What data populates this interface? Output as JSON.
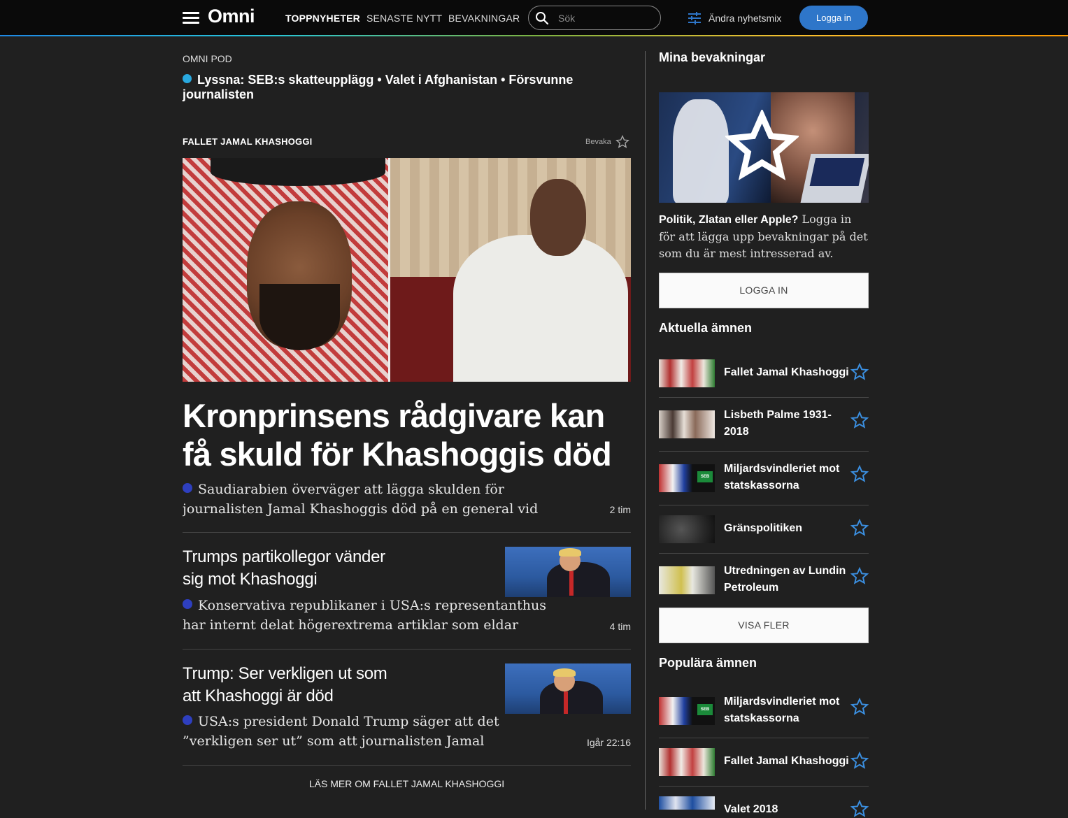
{
  "header": {
    "logo": "Omni",
    "nav": [
      "TOPPNYHETER",
      "SENASTE NYTT",
      "BEVAKNINGAR"
    ],
    "search_placeholder": "Sök",
    "mix_label": "Ändra nyhetsmix",
    "login_label": "Logga in"
  },
  "pod": {
    "label": "OMNI POD",
    "text": "Lyssna: SEB:s skatteupplägg • Valet i Afghanistan • Försvunne journalisten"
  },
  "topic": {
    "label": "FALLET JAMAL KHASHOGGI",
    "follow_label": "Bevaka"
  },
  "main_story": {
    "headline": "Kronprinsens rådgivare kan få skuld för Khashoggis död",
    "lead": "Saudiarabien överväger att lägga skulden för journalisten Jamal Khashoggis död på en general vid namn Ahmed al-Assiri. Det skriver",
    "time": "2 tim"
  },
  "stories": [
    {
      "title": "Trumps partikollegor vänder sig mot Khashoggi",
      "lead": "Konservativa republikaner i USA:s representanthus har internt delat högerextrema artiklar som eldar",
      "time": "4 tim"
    },
    {
      "title": "Trump: Ser verkligen ut som att Khashoggi är död",
      "lead": "USA:s president Donald Trump säger att det ”verkligen ser ut” som att journalisten Jamal Khashoggi är död",
      "time": "Igår 22:16"
    }
  ],
  "more_link": "LÄS MER OM FALLET JAMAL KHASHOGGI",
  "sidebar": {
    "my_follows_title": "Mina bevakningar",
    "promo_bold": "Politik, Zlatan eller Apple?",
    "promo_text": " Logga in för att lägga upp bevakningar på det som du är mest intresserad av.",
    "login_button": "LOGGA IN",
    "current_title": "Aktuella ämnen",
    "current_topics": [
      "Fallet Jamal Khashoggi",
      "Lisbeth Palme 1931-2018",
      "Miljardsvindleriet mot statskassorna",
      "Gränspolitiken",
      "Utredningen av Lundin Petroleum"
    ],
    "show_more": "VISA FLER",
    "popular_title": "Populära ämnen",
    "popular_topics": [
      "Miljardsvindleriet mot statskassorna",
      "Fallet Jamal Khashoggi",
      "Valet 2018"
    ]
  },
  "colors": {
    "accent_blue": "#2e76c9",
    "star_blue": "#3b8fe0",
    "pod_dot": "#29a9e0",
    "story_dot": "#2e3fbf"
  }
}
